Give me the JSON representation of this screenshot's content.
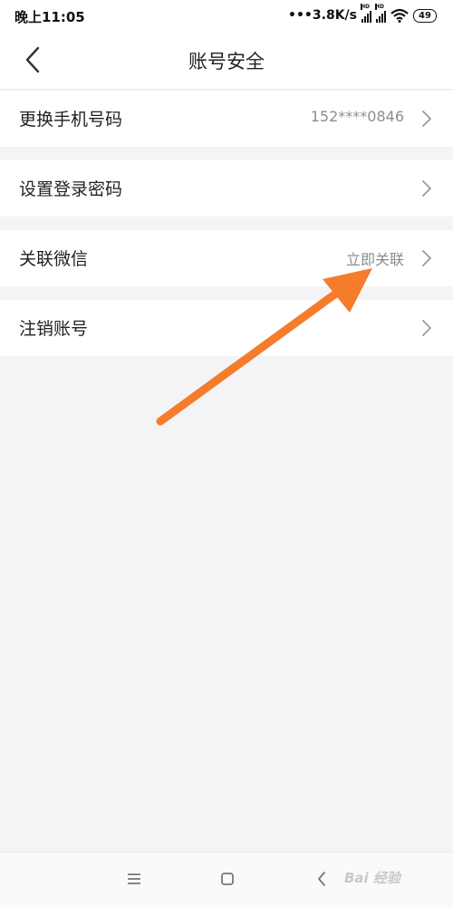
{
  "status_bar": {
    "time": "晚上11:05",
    "net_speed": "3.8K/s",
    "battery": "49",
    "icons": [
      "more-dots-icon",
      "signal-hd-icon",
      "signal-hd-icon",
      "wifi-icon",
      "battery-icon"
    ]
  },
  "header": {
    "title": "账号安全",
    "back_icon": "back-arrow-icon"
  },
  "settings": [
    {
      "label": "更换手机号码",
      "value": "152****0846"
    },
    {
      "label": "设置登录密码",
      "value": ""
    },
    {
      "label": "关联微信",
      "value": "立即关联"
    },
    {
      "label": "注销账号",
      "value": ""
    }
  ],
  "system_nav": {
    "icons": [
      "menu-icon",
      "home-icon",
      "back-icon"
    ]
  },
  "watermark": {
    "text": "Bai 经验"
  },
  "annotation": {
    "color": "#f47c2b"
  },
  "colors": {
    "background": "#f4f4f6",
    "card": "#ffffff",
    "text": "#222222",
    "secondary_text": "#8d8d8d"
  }
}
